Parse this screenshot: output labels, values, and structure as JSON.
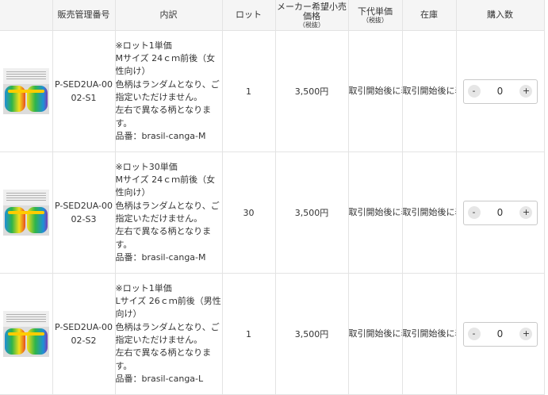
{
  "headers": {
    "code": "販売管理番号",
    "desc": "内訳",
    "lot": "ロット",
    "msrp": "メーカー希望小売価格",
    "msrp_sub": "（税抜）",
    "wholesale": "下代単価",
    "wholesale_sub": "（税抜）",
    "stock": "在庫",
    "qty": "購入数"
  },
  "stepper": {
    "minus": "-",
    "plus": "+"
  },
  "rows": [
    {
      "code": "P-SED2UA-0002-S1",
      "lines": [
        "※ロット1単価",
        "Mサイズ 24ｃｍ前後（女性向け）",
        "色柄はランダムとなり、ご指定いただけません。",
        "左右で異なる柄となります。",
        "品番：brasil-canga-M"
      ],
      "lot": "1",
      "msrp": "3,500円",
      "wholesale": "取引開始後に表示",
      "stock": "取引開始後に表示",
      "qty": "0"
    },
    {
      "code": "P-SED2UA-0002-S3",
      "lines": [
        "※ロット30単価",
        "Mサイズ 24ｃｍ前後（女性向け）",
        "色柄はランダムとなり、ご指定いただけません。",
        "左右で異なる柄となります。",
        "品番：brasil-canga-M"
      ],
      "lot": "30",
      "msrp": "3,500円",
      "wholesale": "取引開始後に表示",
      "stock": "取引開始後に表示",
      "qty": "0"
    },
    {
      "code": "P-SED2UA-0002-S2",
      "lines": [
        "※ロット1単価",
        "Lサイズ 26ｃｍ前後（男性向け）",
        "色柄はランダムとなり、ご指定いただけません。",
        "左右で異なる柄となります。",
        "品番：brasil-canga-L"
      ],
      "lot": "1",
      "msrp": "3,500円",
      "wholesale": "取引開始後に表示",
      "stock": "取引開始後に表示",
      "qty": "0"
    }
  ]
}
